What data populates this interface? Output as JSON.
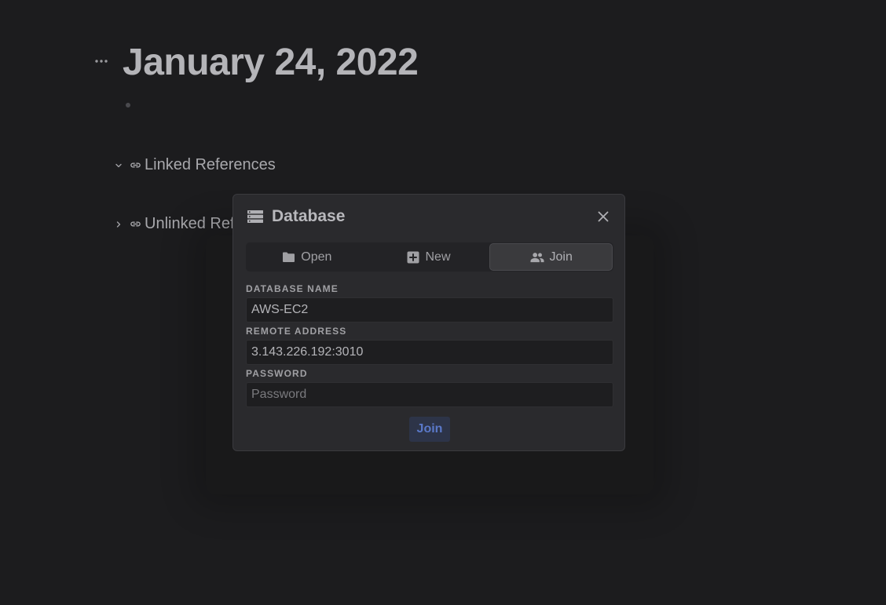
{
  "page": {
    "title": "January 24, 2022",
    "references": {
      "linked_label": "Linked References",
      "unlinked_label": "Unlinked References"
    }
  },
  "modal": {
    "title": "Database",
    "tabs": [
      {
        "label": "Open",
        "icon": "folder-icon",
        "active": false
      },
      {
        "label": "New",
        "icon": "plus-square-icon",
        "active": false
      },
      {
        "label": "Join",
        "icon": "users-icon",
        "active": true
      }
    ],
    "fields": {
      "database_name": {
        "label": "DATABASE NAME",
        "value": "AWS-EC2"
      },
      "remote_address": {
        "label": "REMOTE ADDRESS",
        "value": "3.143.226.192:3010"
      },
      "password": {
        "label": "PASSWORD",
        "value": "",
        "placeholder": "Password"
      }
    },
    "submit_label": "Join"
  },
  "colors": {
    "background": "#1c1c1e",
    "modal_bg": "#2a2a2d",
    "accent": "#5a78c8",
    "accent_bg": "#2d3448"
  }
}
